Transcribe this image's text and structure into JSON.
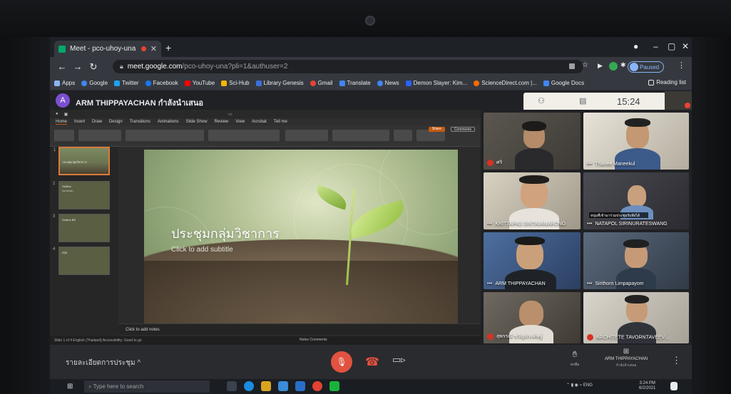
{
  "browser": {
    "tab_title": "Meet - pco-uhoy-una",
    "url_host": "meet.google.com",
    "url_path": "/pco-uhoy-una?pli=1&authuser=2",
    "profile_status": "Paused",
    "bookmarks": [
      {
        "label": "Apps",
        "color": "#8ab4f8"
      },
      {
        "label": "Google",
        "color": "#4285f4"
      },
      {
        "label": "Twitter",
        "color": "#1da1f2"
      },
      {
        "label": "Facebook",
        "color": "#1877f2"
      },
      {
        "label": "YouTube",
        "color": "#ff0000"
      },
      {
        "label": "Sci-Hub",
        "color": "#f5b700"
      },
      {
        "label": "Library Genesis",
        "color": "#3b6fd8"
      },
      {
        "label": "Gmail",
        "color": "#ea4335"
      },
      {
        "label": "Translate",
        "color": "#4285f4"
      },
      {
        "label": "News",
        "color": "#4285f4"
      },
      {
        "label": "Demon Slayer: Kim...",
        "color": "#2a62ff"
      },
      {
        "label": "ScienceDirect.com |...",
        "color": "#ff6c00"
      },
      {
        "label": "Google Docs",
        "color": "#4285f4"
      }
    ],
    "reading_list": "Reading list"
  },
  "meet": {
    "presenter_initial": "A",
    "presenter_title": "ARM THIPPAYACHAN กำลังนำเสนอ",
    "time": "15:24",
    "meeting_details": "รายละเอียดการประชุม ^",
    "raise_hand_label": "ยกมือ",
    "present_label": "ARM THIPPAYACHAN",
    "present_sublabel": "กำลังนำเสนอ"
  },
  "powerpoint": {
    "menu": [
      "Home",
      "Insert",
      "Draw",
      "Design",
      "Transitions",
      "Animations",
      "Slide Show",
      "Review",
      "View",
      "Acrobat",
      "Tell me"
    ],
    "share_label": "Share",
    "comments_label": "Comments",
    "slide_title": "ประชุมกลุ่มวิชาการ",
    "slide_subtitle": "Click to add subtitle",
    "notes_placeholder": "Click to add notes",
    "status_left": "Slide 1 of 4   English (Thailand)   Accessibility: Good to go",
    "status_right": "Notes   Comments",
    "thumbnails": [
      {
        "num": "1",
        "title": "ประชุมกลุ่มวิชาการ",
        "sub": ""
      },
      {
        "num": "2",
        "title": "Outline",
        "sub": "แนะนำกลุ่ม..."
      },
      {
        "num": "3",
        "title": "Outline ต่อ",
        "sub": "..."
      },
      {
        "num": "4",
        "title": "สรุป",
        "sub": ""
      }
    ]
  },
  "participants": [
    {
      "name": "ศริ",
      "mic_muted": true
    },
    {
      "name": "Thanee Maneekul",
      "mic_muted": false
    },
    {
      "name": "KRITTAPAS SINTAVANARONG",
      "mic_muted": false
    },
    {
      "name": "NATAPOL SIRINURATESWANG",
      "mic_muted": false,
      "caption": "หนุ่มที่เข้ามาร่วมประชุมรับฟังได้"
    },
    {
      "name": "ARM THIPPAYACHAN",
      "mic_muted": false
    },
    {
      "name": "Sirithorn Limpapayom",
      "mic_muted": false
    },
    {
      "name": "สุพรรณี ขวัญประดิษฐ์",
      "mic_muted": true
    },
    {
      "name": "ARCHITETE TAVORNTAVEEV...",
      "mic_muted": true
    }
  ],
  "taskbar": {
    "search_placeholder": "Type here to search",
    "tray_lang": "ENG",
    "tray_time": "3:24 PM",
    "tray_date": "6/2/2021"
  }
}
